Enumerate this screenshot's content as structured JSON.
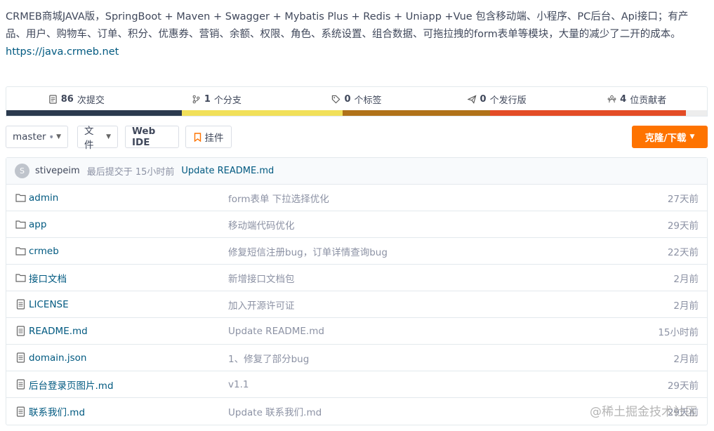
{
  "repo": {
    "description": "CRMEB商城JAVA版，SpringBoot + Maven + Swagger + Mybatis Plus + Redis + Uniapp +Vue 包含移动端、小程序、PC后台、Api接口；有产品、用户、购物车、订单、积分、优惠券、营销、余额、权限、角色、系统设置、组合数据、可拖拉拽的form表单等模块，大量的减少了二开的成本。",
    "homepage": "https://java.crmeb.net"
  },
  "stats": [
    {
      "icon": "commit-icon",
      "count": "86",
      "label": "次提交"
    },
    {
      "icon": "branch-icon",
      "count": "1",
      "label": "个分支"
    },
    {
      "icon": "tag-icon",
      "count": "0",
      "label": "个标签"
    },
    {
      "icon": "release-icon",
      "count": "0",
      "label": "个发行版"
    },
    {
      "icon": "contributors-icon",
      "count": "4",
      "label": "位贡献者"
    }
  ],
  "language_bar": [
    {
      "color": "#2b3a4e",
      "fraction": 0.25
    },
    {
      "color": "#f1e05a",
      "fraction": 0.23
    },
    {
      "color": "#b07219",
      "fraction": 0.21
    },
    {
      "color": "#e34c26",
      "fraction": 0.28
    },
    {
      "color": "#ededed",
      "fraction": 0.03
    }
  ],
  "toolbar": {
    "branch_label": "master",
    "file_label": "文件",
    "webide_label": "Web IDE",
    "widget_label": "挂件",
    "clone_label": "克隆/下载"
  },
  "last_commit": {
    "avatar_letter": "S",
    "author": "stivepeim",
    "time": "最后提交于 15小时前",
    "message": "Update README.md"
  },
  "files": [
    {
      "type": "folder",
      "name": "admin",
      "message": "form表单 下拉选择优化",
      "time": "27天前"
    },
    {
      "type": "folder",
      "name": "app",
      "message": "移动端代码优化",
      "time": "29天前"
    },
    {
      "type": "folder",
      "name": "crmeb",
      "message": "修复短信注册bug，订单详情查询bug",
      "time": "22天前"
    },
    {
      "type": "folder",
      "name": "接口文档",
      "message": "新增接口文档包",
      "time": "2月前"
    },
    {
      "type": "file",
      "name": "LICENSE",
      "message": "加入开源许可证",
      "time": "2月前"
    },
    {
      "type": "file",
      "name": "README.md",
      "message": "Update README.md",
      "time": "15小时前"
    },
    {
      "type": "file",
      "name": "domain.json",
      "message": "1、修复了部分bug",
      "time": "2月前"
    },
    {
      "type": "file",
      "name": "后台登录页图片.md",
      "message": "v1.1",
      "time": "29天前"
    },
    {
      "type": "file",
      "name": "联系我们.md",
      "message": "Update 联系我们.md",
      "time": "29天前"
    }
  ],
  "watermark": "@稀土掘金技术社区"
}
